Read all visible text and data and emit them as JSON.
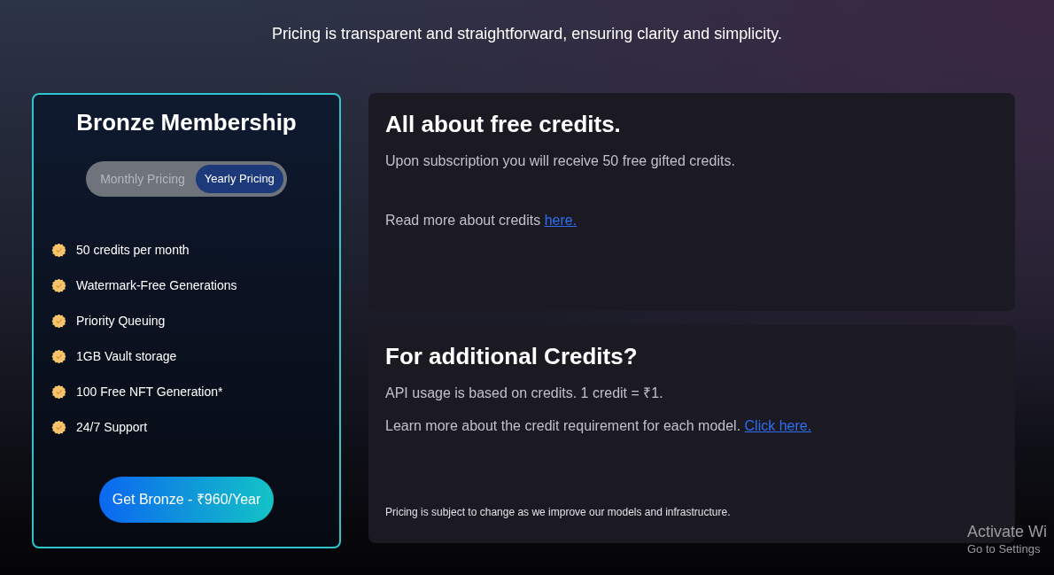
{
  "subtitle": "Pricing is transparent and straightforward, ensuring clarity and simplicity.",
  "plan": {
    "title": "Bronze Membership",
    "billing_options": [
      {
        "label": "Monthly Pricing",
        "selected": false
      },
      {
        "label": "Yearly Pricing",
        "selected": true
      }
    ],
    "features": [
      "50 credits per month",
      "Watermark-Free Generations",
      "Priority Queuing",
      "1GB Vault storage",
      "100 Free NFT Generation*",
      "24/7 Support"
    ],
    "cta": "Get Bronze - ₹960/Year"
  },
  "info_cards": [
    {
      "title": "All about free credits.",
      "paragraphs": [
        {
          "text": "Upon subscription you will receive 50 free gifted credits."
        },
        {
          "text": "Read more about credits",
          "link": "here."
        }
      ]
    },
    {
      "title": "For additional Credits?",
      "paragraphs": [
        {
          "text": "API usage is based on credits. 1 credit = ₹1."
        },
        {
          "text": "Learn more about the credit requirement for each model.",
          "link": "Click here."
        }
      ],
      "footnote": "Pricing is subject to change as we improve our models and infrastructure."
    }
  ],
  "os_notice": {
    "title": "Activate Wi",
    "subtitle": "Go to Settings"
  }
}
